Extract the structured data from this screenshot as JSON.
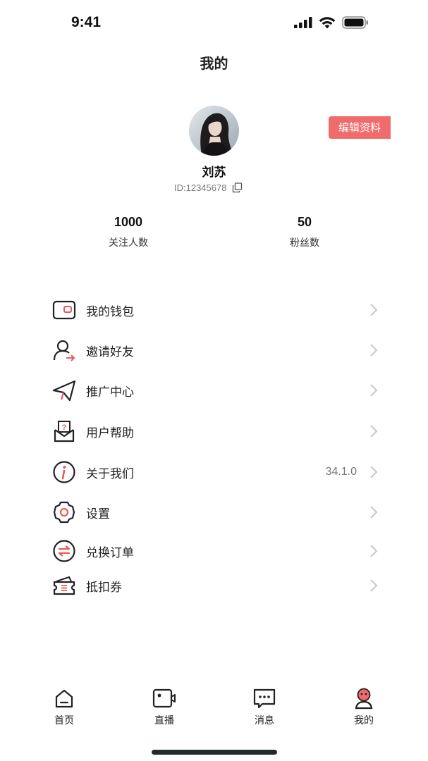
{
  "status_bar": {
    "time": "9:41",
    "icons": [
      "signal-icon",
      "wifi-icon",
      "battery-icon"
    ]
  },
  "header": {
    "title": "我的"
  },
  "profile": {
    "name": "刘苏",
    "id_text": "ID:12345678",
    "edit_label": "编辑资料",
    "accent": "#f06b6b"
  },
  "stats": [
    {
      "value": "1000",
      "label": "关注人数"
    },
    {
      "value": "50",
      "label": "粉丝数"
    }
  ],
  "menu": [
    {
      "label": "我的钱包",
      "icon": "wallet-icon",
      "value": ""
    },
    {
      "label": "邀请好友",
      "icon": "invite-user-icon",
      "value": ""
    },
    {
      "label": "推广中心",
      "icon": "paper-plane-icon",
      "value": ""
    },
    {
      "label": "用户帮助",
      "icon": "help-mail-icon",
      "value": ""
    },
    {
      "label": "关于我们",
      "icon": "info-icon",
      "value": "34.1.0"
    },
    {
      "label": "设置",
      "icon": "gear-icon",
      "value": ""
    },
    {
      "label": "兑换订单",
      "icon": "exchange-icon",
      "value": ""
    },
    {
      "label": "抵扣券",
      "icon": "coupon-icon",
      "value": ""
    }
  ],
  "tabs": [
    {
      "label": "首页",
      "icon": "home-icon",
      "active": false
    },
    {
      "label": "直播",
      "icon": "live-camera-icon",
      "active": false
    },
    {
      "label": "消息",
      "icon": "message-icon",
      "active": false
    },
    {
      "label": "我的",
      "icon": "profile-icon",
      "active": true
    }
  ]
}
